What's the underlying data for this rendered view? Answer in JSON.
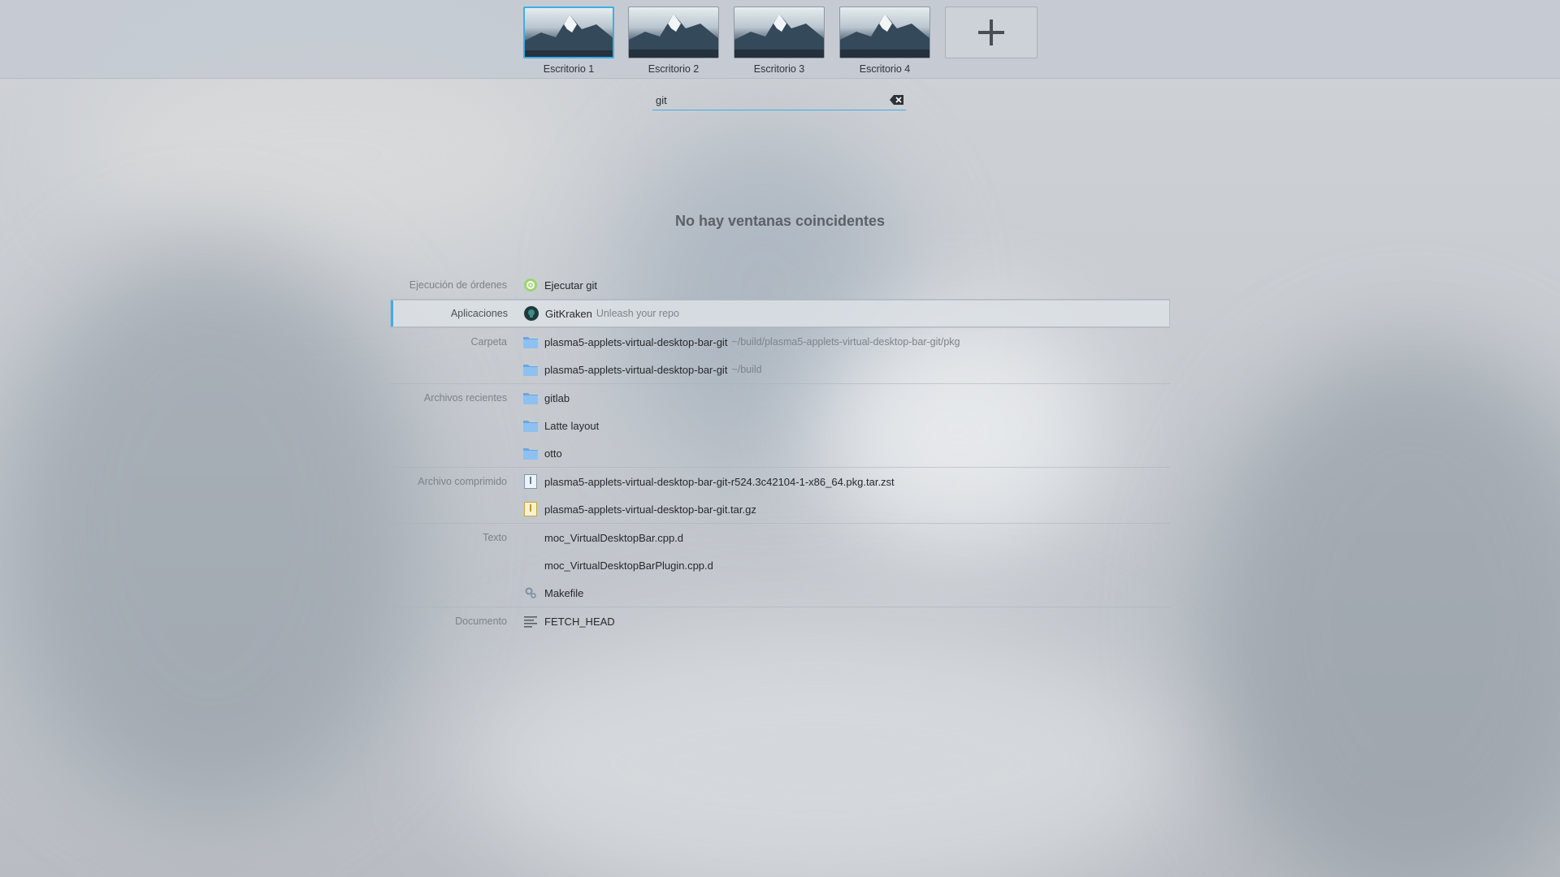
{
  "desktops": [
    {
      "label": "Escritorio 1",
      "active": true
    },
    {
      "label": "Escritorio 2",
      "active": false
    },
    {
      "label": "Escritorio 3",
      "active": false
    },
    {
      "label": "Escritorio 4",
      "active": false
    }
  ],
  "add_desktop_icon": "plus-icon",
  "search": {
    "value": "git",
    "clear_icon": "backspace-clear-icon"
  },
  "empty_message": "No hay ventanas coincidentes",
  "colors": {
    "accent": "#3daee9",
    "folder": "#7cb5ec"
  },
  "results": {
    "groups": [
      {
        "category": "Ejecución de órdenes",
        "items": [
          {
            "title": "Ejecutar git",
            "subtitle": "",
            "icon": "gear-icon"
          }
        ]
      },
      {
        "category": "Aplicaciones",
        "items": [
          {
            "title": "GitKraken",
            "subtitle": "Unleash your repo",
            "icon": "gitkraken-icon"
          }
        ]
      },
      {
        "category": "Carpeta",
        "items": [
          {
            "title": "plasma5-applets-virtual-desktop-bar-git",
            "subtitle": "~/build/plasma5-applets-virtual-desktop-bar-git/pkg",
            "icon": "folder-icon"
          },
          {
            "title": "plasma5-applets-virtual-desktop-bar-git",
            "subtitle": "~/build",
            "icon": "folder-icon"
          }
        ]
      },
      {
        "category": "Archivos recientes",
        "items": [
          {
            "title": "gitlab",
            "subtitle": "",
            "icon": "folder-icon"
          },
          {
            "title": "Latte layout",
            "subtitle": "",
            "icon": "folder-icon"
          },
          {
            "title": "otto",
            "subtitle": "",
            "icon": "folder-icon"
          }
        ]
      },
      {
        "category": "Archivo comprimido",
        "items": [
          {
            "title": "plasma5-applets-virtual-desktop-bar-git-r524.3c42104-1-x86_64.pkg.tar.zst",
            "subtitle": "",
            "icon": "archive-icon"
          },
          {
            "title": "plasma5-applets-virtual-desktop-bar-git.tar.gz",
            "subtitle": "",
            "icon": "archive-yellow-icon"
          }
        ]
      },
      {
        "category": "Texto",
        "items": [
          {
            "title": "moc_VirtualDesktopBar.cpp.d",
            "subtitle": "",
            "icon": "blank-icon"
          },
          {
            "title": "moc_VirtualDesktopBarPlugin.cpp.d",
            "subtitle": "",
            "icon": "blank-icon"
          },
          {
            "title": "Makefile",
            "subtitle": "",
            "icon": "makefile-gears-icon"
          }
        ]
      },
      {
        "category": "Documento",
        "items": [
          {
            "title": "FETCH_HEAD",
            "subtitle": "",
            "icon": "text-document-icon"
          }
        ]
      }
    ],
    "selected": "GitKraken"
  }
}
